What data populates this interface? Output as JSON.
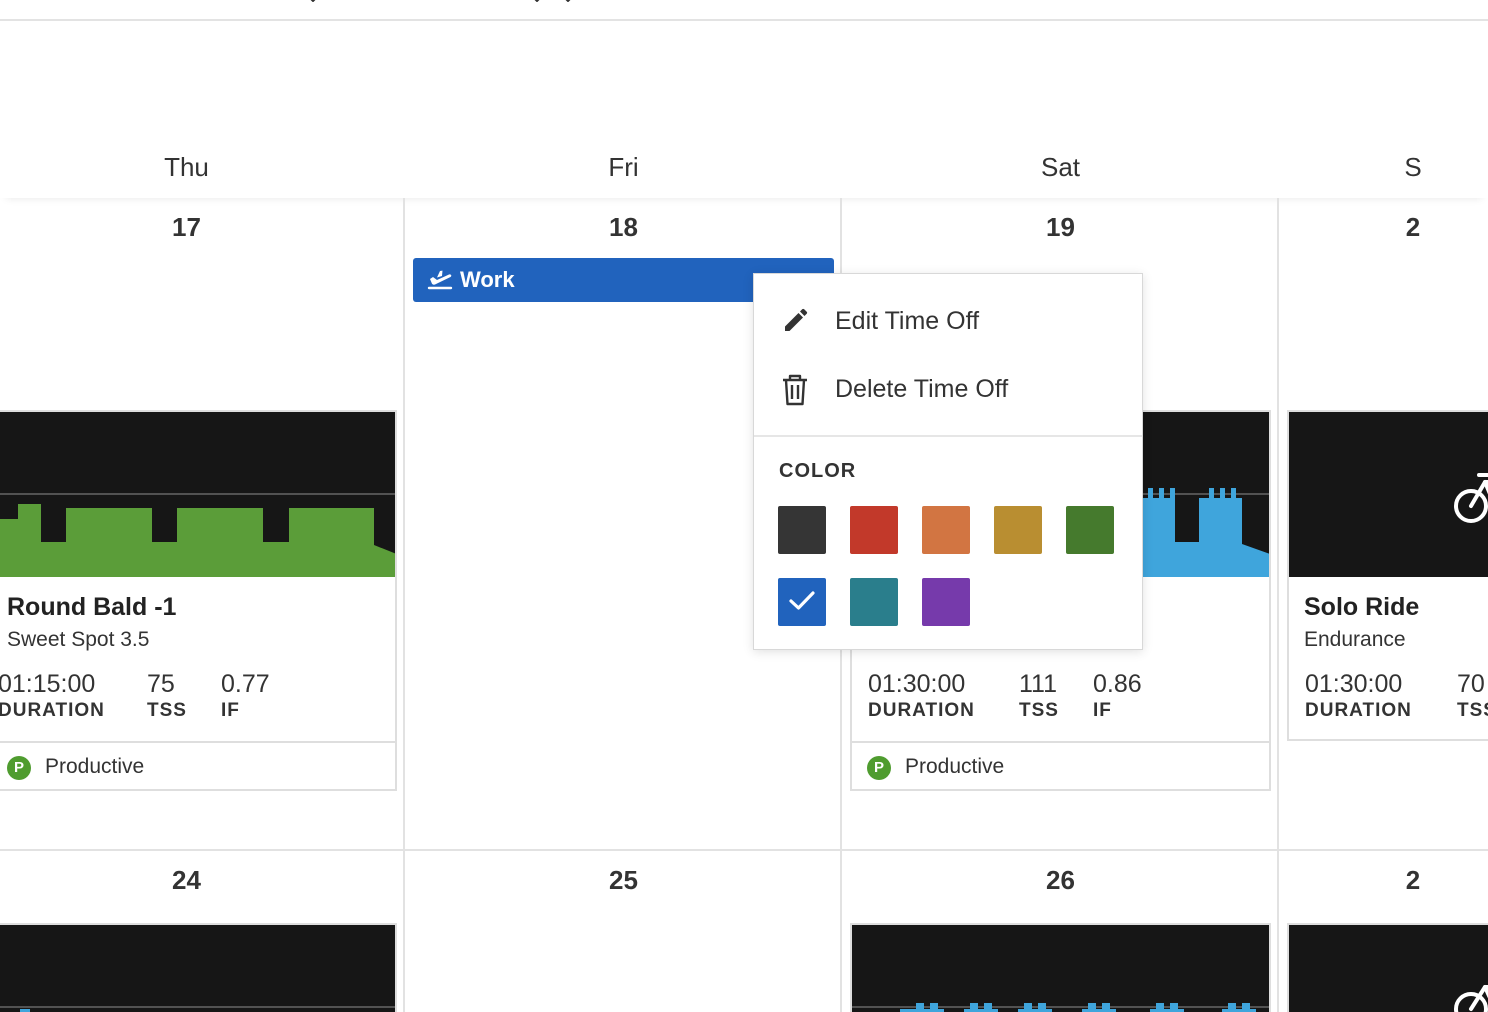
{
  "colors": {
    "accent_blue": "#2163bd",
    "graph_bg": "#161616",
    "graph_green": "#5b9d39",
    "graph_blue": "#3fa5dc",
    "productive_green": "#4f9c2f"
  },
  "day_headers": [
    "Thu",
    "Fri",
    "Sat",
    "S"
  ],
  "weeks": [
    {
      "days": [
        "17",
        "18",
        "19",
        "2"
      ]
    },
    {
      "days": [
        "24",
        "25",
        "26",
        "2"
      ]
    }
  ],
  "time_off": {
    "label": "Work",
    "icon": "airplane-takeoff-icon"
  },
  "context_menu": {
    "edit_label": "Edit Time Off",
    "edit_icon": "pencil-icon",
    "delete_label": "Delete Time Off",
    "delete_icon": "trash-icon",
    "color_heading": "COLOR",
    "selected_color": "#2163bd",
    "swatches": [
      "#353535",
      "#c2392a",
      "#d27542",
      "#b98e31",
      "#457a2d",
      "#2163bd",
      "#2a7e8c",
      "#763aab"
    ]
  },
  "workouts": [
    {
      "title": "Round Bald -1",
      "subtitle": "Sweet Spot 3.5",
      "metrics": [
        {
          "value": "01:15:00",
          "label": "DURATION"
        },
        {
          "value": "75",
          "label": "TSS"
        },
        {
          "value": "0.77",
          "label": "IF"
        }
      ],
      "status": {
        "badge": "P",
        "text": "Productive"
      }
    },
    {
      "metrics": [
        {
          "value": "01:30:00",
          "label": "DURATION"
        },
        {
          "value": "111",
          "label": "TSS"
        },
        {
          "value": "0.86",
          "label": "IF"
        }
      ],
      "status": {
        "badge": "P",
        "text": "Productive"
      }
    },
    {
      "title": "Solo Ride",
      "subtitle": "Endurance",
      "icon": "bicycle-icon",
      "metrics": [
        {
          "value": "01:30:00",
          "label": "DURATION"
        },
        {
          "value": "70",
          "label": "TSS"
        }
      ]
    }
  ]
}
